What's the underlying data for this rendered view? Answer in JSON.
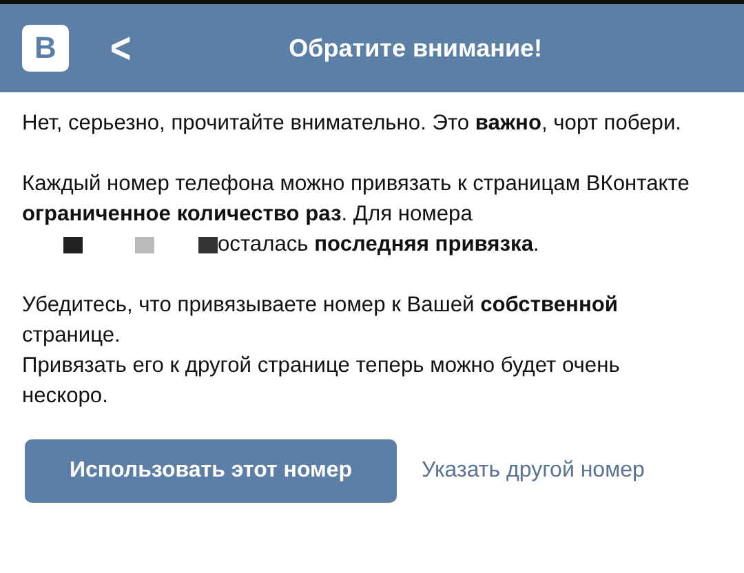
{
  "header": {
    "logo": "В",
    "back": "<",
    "title": "Обратите внимание!"
  },
  "paragraphs": [
    {
      "text": "Нет, серьезно, прочитайте внимательно. Это **важно**, чорт побери."
    },
    {
      "text": "Каждый номер телефона можно привязать к страницам ВКонтакте **ограниченное количество раз**. Для номера"
    },
    {
      "kind": "redacted",
      "text": "осталась **последняя привязка**."
    },
    {
      "text": "Убедитесь, что привязываете номер к Вашей **собственной** странице."
    },
    {
      "kind": "tight",
      "text": "Привязать его к другой странице теперь можно будет очень нескоро."
    }
  ],
  "buttons": [
    {
      "kind": "primary",
      "label": "Использовать этот номер"
    },
    {
      "kind": "link",
      "label": "Указать другой номер"
    }
  ]
}
